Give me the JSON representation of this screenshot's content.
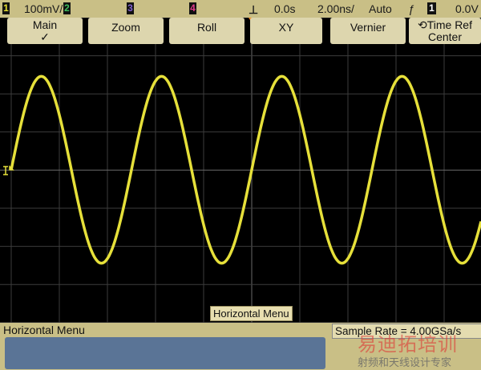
{
  "status_bar": {
    "ch1": "1",
    "ch1_scale": "100mV/",
    "ch2": "2",
    "ch3": "3",
    "ch4": "4",
    "delay": "0.0s",
    "timebase": "2.00ns/",
    "trigger_mode": "Auto",
    "trigger_slope_icon": "rising-edge-icon",
    "trigger_source": "1",
    "trigger_level": "0.0V"
  },
  "colors": {
    "ch1": "#e8e030",
    "ch2": "#3fbf5f",
    "ch3": "#8060d0",
    "ch4": "#e03a8a",
    "trace": "#e6e03a",
    "trigger_marker": "#f08a20"
  },
  "waveform": {
    "amplitude_div": 2.45,
    "period_div": 2.5,
    "phase": "rising-at-center"
  },
  "screen_label": "Horizontal Menu",
  "menu": {
    "title": "Horizontal Menu",
    "sample_rate": "Sample Rate = 4.00GSa/s",
    "softkeys": [
      {
        "label": "Main",
        "sub": "✓"
      },
      {
        "label": "Zoom",
        "sub": ""
      },
      {
        "label": "Roll",
        "sub": ""
      },
      {
        "label": "XY",
        "sub": ""
      },
      {
        "label": "Vernier",
        "sub": ""
      },
      {
        "label": "Time Ref",
        "sub": "Center"
      }
    ]
  },
  "watermark": {
    "line1": "易迪拓培训",
    "line2": "射频和天线设计专家"
  }
}
